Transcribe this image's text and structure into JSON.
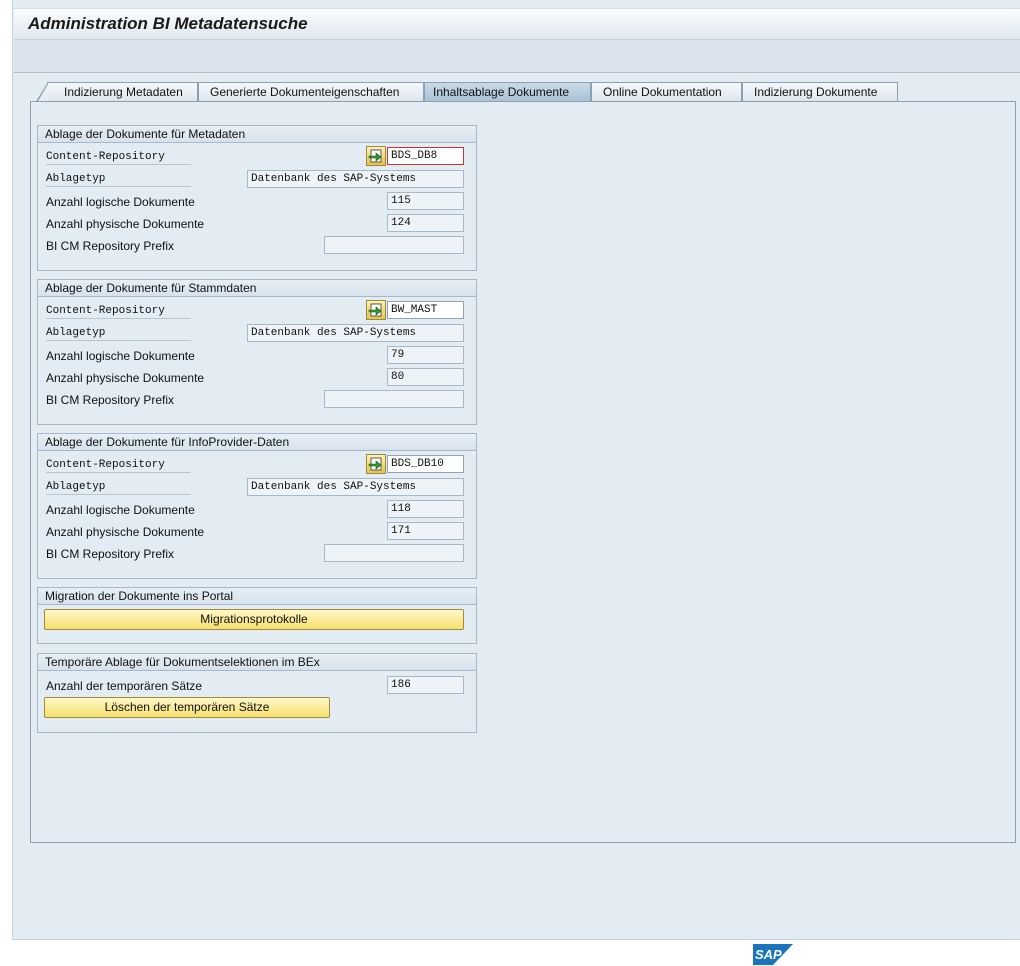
{
  "window": {
    "title": "Administration BI Metadatensuche"
  },
  "tabs": [
    {
      "label": "Indizierung Metadaten"
    },
    {
      "label": "Generierte Dokumenteigenschaften"
    },
    {
      "label": "Inhaltsablage Dokumente"
    },
    {
      "label": "Online Dokumentation"
    },
    {
      "label": "Indizierung Dokumente"
    }
  ],
  "active_tab": "Inhaltsablage Dokumente",
  "groups": {
    "metadaten": {
      "title": "Ablage der Dokumente für Metadaten",
      "repo_label": "Content-Repository",
      "repo_value": "BDS_DB8",
      "type_label": "Ablagetyp",
      "type_value": "Datenbank des SAP-Systems",
      "log_label": "Anzahl logische Dokumente",
      "log_value": "115",
      "phys_label": "Anzahl physische Dokumente",
      "phys_value": "124",
      "prefix_label": "BI CM Repository Prefix",
      "prefix_value": ""
    },
    "stammdaten": {
      "title": "Ablage der Dokumente für Stammdaten",
      "repo_label": "Content-Repository",
      "repo_value": "BW_MAST",
      "type_label": "Ablagetyp",
      "type_value": "Datenbank des SAP-Systems",
      "log_label": "Anzahl logische Dokumente",
      "log_value": "79",
      "phys_label": "Anzahl physische Dokumente",
      "phys_value": "80",
      "prefix_label": "BI CM Repository Prefix",
      "prefix_value": ""
    },
    "infoprovider": {
      "title": "Ablage der Dokumente für InfoProvider-Daten",
      "repo_label": "Content-Repository",
      "repo_value": "BDS_DB10",
      "type_label": "Ablagetyp",
      "type_value": "Datenbank des SAP-Systems",
      "log_label": "Anzahl logische Dokumente",
      "log_value": "118",
      "phys_label": "Anzahl physische Dokumente",
      "phys_value": "171",
      "prefix_label": "BI CM Repository Prefix",
      "prefix_value": ""
    },
    "migration": {
      "title": "Migration der Dokumente ins Portal",
      "button_label": "Migrationsprotokolle"
    },
    "temp": {
      "title": "Temporäre Ablage für Dokumentselektionen im BEx",
      "count_label": "Anzahl der temporären Sätze",
      "count_value": "186",
      "button_label": "Löschen der temporären Sätze"
    }
  },
  "footer": {
    "logo_text": "SAP"
  },
  "colors": {
    "accent_button": "#f5df6e",
    "panel_bg": "#e3ecf3",
    "sap_blue": "#1b75bb"
  }
}
